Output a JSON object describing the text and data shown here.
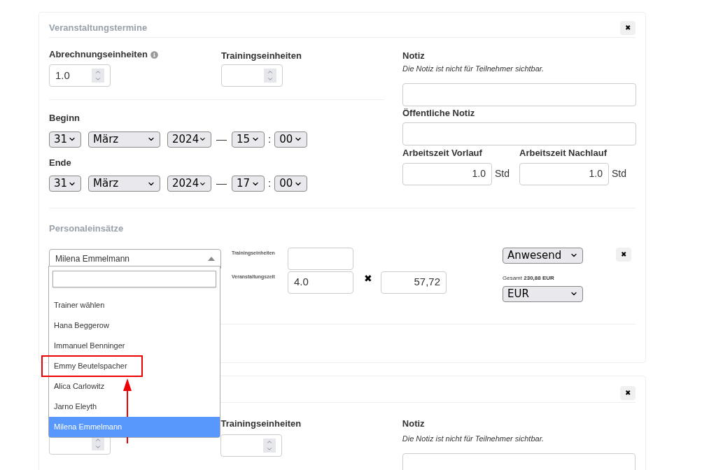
{
  "event_card": {
    "title": "Veranstaltungstermine",
    "close_button": "✖",
    "billing_units": {
      "label": "Abrechnungseinheiten",
      "value": "1.0"
    },
    "training_units": {
      "label": "Trainingseinheiten"
    },
    "start": {
      "label": "Beginn",
      "day": "31",
      "month": "März",
      "year": "2024",
      "hour": "15",
      "minute": "00"
    },
    "end": {
      "label": "Ende",
      "day": "31",
      "month": "März",
      "year": "2024",
      "hour": "17",
      "minute": "00"
    },
    "dash": "—",
    "colon": ":",
    "note": {
      "label": "Notiz",
      "hint": "Die Notiz ist nicht für Teilnehmer sichtbar."
    },
    "public_note": {
      "label": "Öffentliche Notiz"
    },
    "work_before": {
      "label": "Arbeitszeit Vorlauf",
      "value": "1.0",
      "unit": "Std"
    },
    "work_after": {
      "label": "Arbeitszeit Nachlauf",
      "value": "1.0",
      "unit": "Std"
    }
  },
  "staff": {
    "title": "Personaleinsätze",
    "trainer_select": {
      "value": "Milena Emmelmann",
      "expanded": true,
      "options": [
        {
          "label": "Trainer wählen",
          "selected": false,
          "highlighted": false
        },
        {
          "label": "Hana Beggerow",
          "selected": false,
          "highlighted": false
        },
        {
          "label": "Immanuel Benninger",
          "selected": false,
          "highlighted": false
        },
        {
          "label": "Emmy Beutelspacher",
          "selected": false,
          "highlighted": true
        },
        {
          "label": "Alica Carlowitz",
          "selected": false,
          "highlighted": false
        },
        {
          "label": "Jarno Eleyth",
          "selected": false,
          "highlighted": false
        },
        {
          "label": "Milena Emmelmann",
          "selected": true,
          "highlighted": false
        }
      ]
    },
    "training_units_label": "Trainingseinheiten",
    "event_time_label": "Veranstaltungszeit",
    "event_time": "4.0",
    "multiply": "✖",
    "rate": "57,72",
    "status": "Anwesend",
    "total": "Gesamt **230,88 EUR**",
    "currency": "EUR",
    "remove_button": "✖"
  },
  "second_card": {
    "close_button": "✖",
    "training_units_label": "Trainingseinheiten",
    "note": {
      "label": "Notiz",
      "hint": "Die Notiz ist nicht für Teilnehmer sichtbar."
    }
  }
}
